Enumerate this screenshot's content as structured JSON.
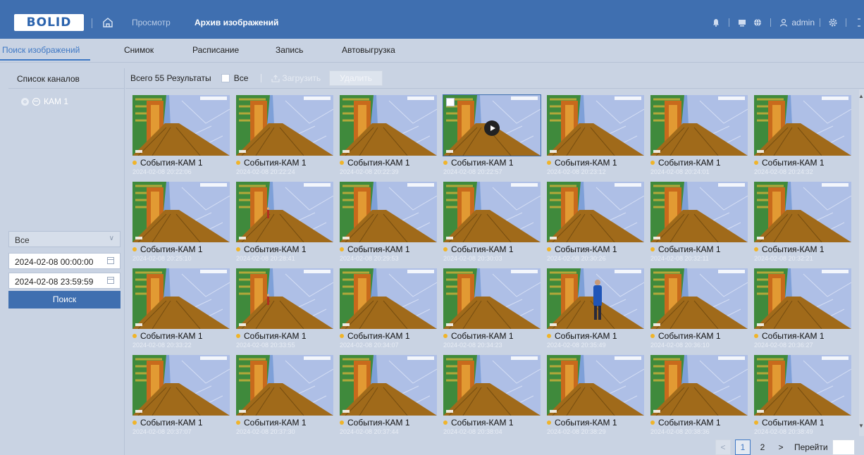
{
  "topbar": {
    "logo_text": "BOLID",
    "nav": [
      "Просмотр",
      "Архив изображений"
    ],
    "active_nav": 1,
    "user": "admin"
  },
  "subtabs": [
    "Поиск изображений",
    "Снимок",
    "Расписание",
    "Запись",
    "Автовыгрузка"
  ],
  "active_subtab": 0,
  "left": {
    "header": "Список каналов",
    "channel": "КАМ 1",
    "event_type": "Все",
    "start_date": "2024-02-08 00:00:00",
    "end_date": "2024-02-08 23:59:59",
    "search_label": "Поиск"
  },
  "toolbar": {
    "results": "Всего 55 Результаты",
    "select_all": "Все",
    "upload": "Загрузить",
    "delete": "Удалить"
  },
  "images": [
    {
      "label": "События-КАМ 1",
      "time": "2024-02-08 20:22:06"
    },
    {
      "label": "События-КАМ 1",
      "time": "2024-02-08 20:22:24"
    },
    {
      "label": "События-КАМ 1",
      "time": "2024-02-08 20:22:39"
    },
    {
      "label": "События-КАМ 1",
      "time": "2024-02-08 20:22:57",
      "selected": true
    },
    {
      "label": "События-КАМ 1",
      "time": "2024-02-08 20:23:12"
    },
    {
      "label": "События-КАМ 1",
      "time": "2024-02-08 20:24:01"
    },
    {
      "label": "События-КАМ 1",
      "time": "2024-02-08 20:24:32"
    },
    {
      "label": "События-КАМ 1",
      "time": "2024-02-08 20:25:10"
    },
    {
      "label": "События-КАМ 1",
      "time": "2024-02-08 20:28:41",
      "figure": "small"
    },
    {
      "label": "События-КАМ 1",
      "time": "2024-02-08 20:29:53"
    },
    {
      "label": "События-КАМ 1",
      "time": "2024-02-08 20:30:03"
    },
    {
      "label": "События-КАМ 1",
      "time": "2024-02-08 20:30:26"
    },
    {
      "label": "События-КАМ 1",
      "time": "2024-02-08 20:32:11"
    },
    {
      "label": "События-КАМ 1",
      "time": "2024-02-08 20:32:21"
    },
    {
      "label": "События-КАМ 1",
      "time": "2024-02-08 20:33:22"
    },
    {
      "label": "События-КАМ 1",
      "time": "2024-02-08 20:33:55",
      "figure": "small"
    },
    {
      "label": "События-КАМ 1",
      "time": "2024-02-08 20:34:07"
    },
    {
      "label": "События-КАМ 1",
      "time": "2024-02-08 20:34:23"
    },
    {
      "label": "События-КАМ 1",
      "time": "2024-02-08 20:35:49",
      "figure": "large"
    },
    {
      "label": "События-КАМ 1",
      "time": "2024-02-08 20:36:10"
    },
    {
      "label": "События-КАМ 1",
      "time": "2024-02-08 20:36:27"
    },
    {
      "label": "События-КАМ 1",
      "time": "2024-02-08 20:37:07"
    },
    {
      "label": "События-КАМ 1",
      "time": "2024-02-08 20:37:30"
    },
    {
      "label": "События-КАМ 1",
      "time": "2024-02-08 20:37:44"
    },
    {
      "label": "События-КАМ 1",
      "time": "2024-02-08 20:38:04"
    },
    {
      "label": "События-КАМ 1",
      "time": "2024-02-08 20:38:29"
    },
    {
      "label": "События-КАМ 1",
      "time": "2024-02-08 20:38:36"
    },
    {
      "label": "События-КАМ 1",
      "time": "2024-02-08 20:38:49"
    }
  ],
  "pagination": {
    "pages": [
      "1",
      "2"
    ],
    "current": "1",
    "goto_label": "Перейти"
  },
  "colors": {
    "topbar": "#3f6fb0",
    "background": "#c9d3e3",
    "accent": "#3f78c4",
    "event_dot": "#f0b429"
  }
}
